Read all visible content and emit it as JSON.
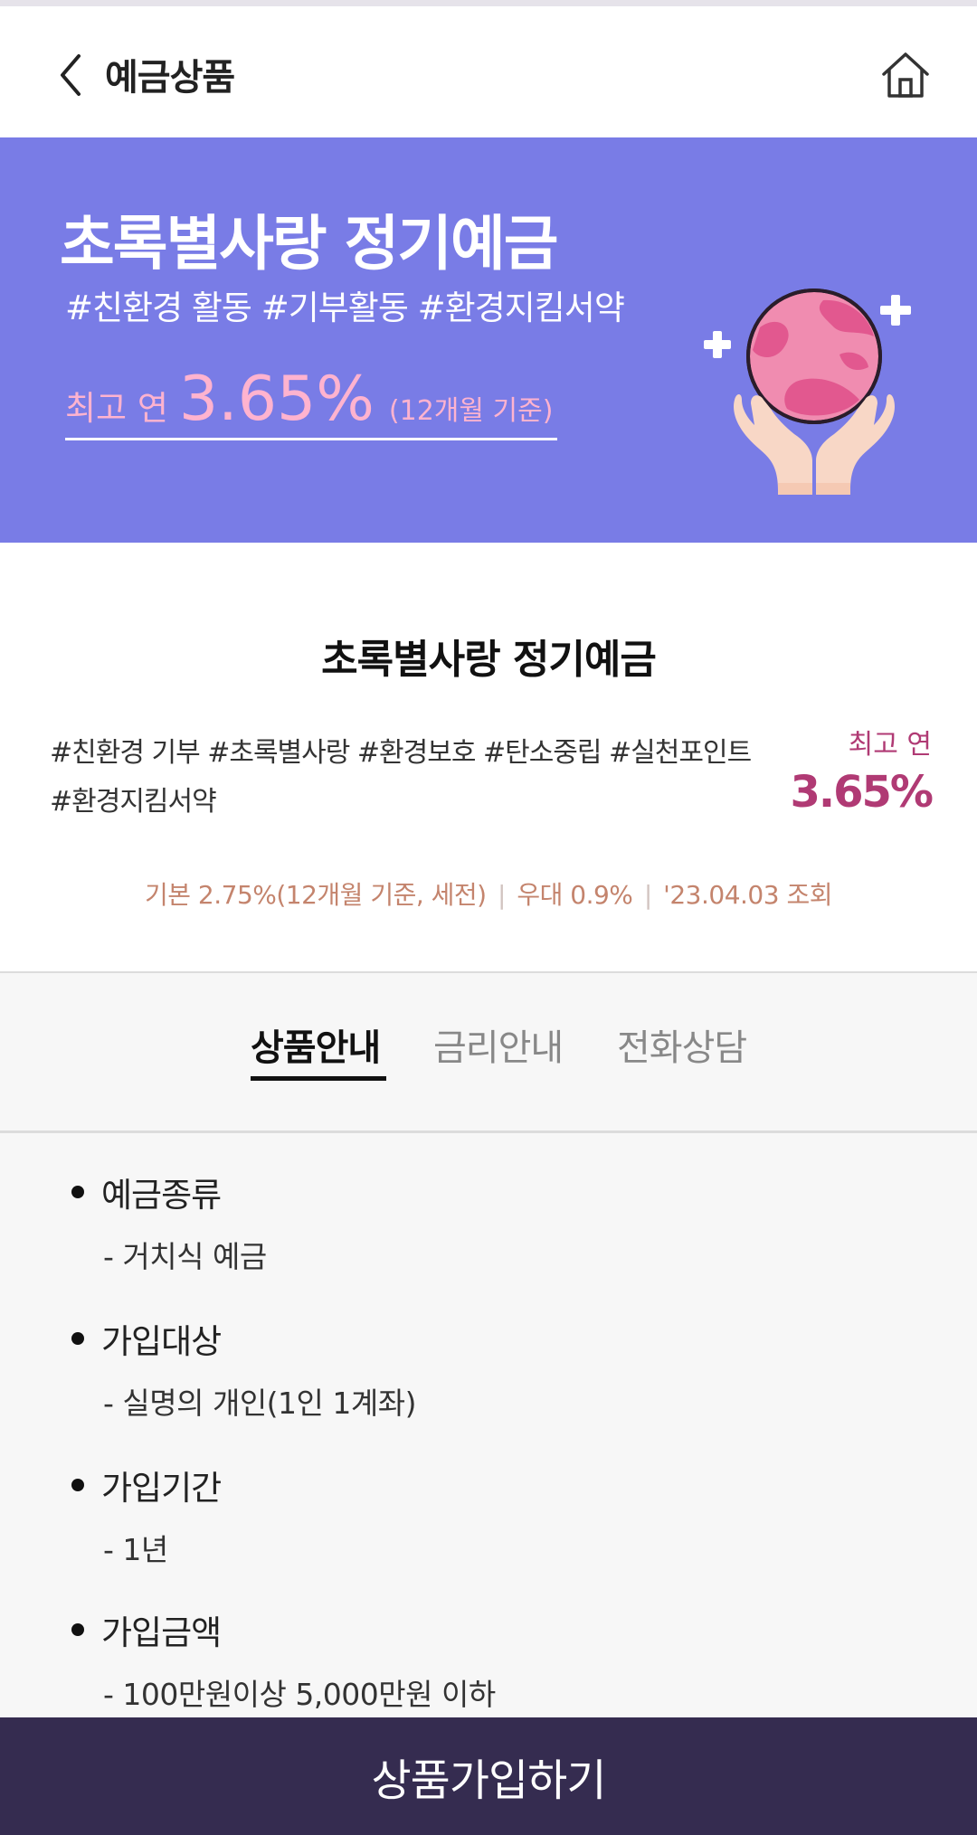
{
  "header": {
    "title": "예금상품",
    "back_icon": "chevron-left-icon",
    "home_icon": "home-icon"
  },
  "banner": {
    "title": "초록별사랑 정기예금",
    "tags": "#친환경 활동 #기부활동 #환경지킴서약",
    "rate_prefix": "최고 연",
    "rate_value": "3.65%",
    "rate_note": "(12개월 기준)",
    "illustration": "globe-in-hands-icon",
    "bg_color": "#797ce6"
  },
  "product": {
    "title": "초록별사랑 정기예금",
    "tags": "#친환경 기부 #초록별사랑 #환경보호 #탄소중립 #실천포인트 #환경지킴서약",
    "rate_label": "최고 연",
    "rate_value": "3.65%",
    "detail_base": "기본 2.75%(12개월 기준, 세전)",
    "detail_bonus": "우대 0.9%",
    "detail_date": "'23.04.03 조회",
    "accent_color": "#b03a74"
  },
  "tabs": [
    {
      "label": "상품안내",
      "active": true
    },
    {
      "label": "금리안내",
      "active": false
    },
    {
      "label": "전화상담",
      "active": false
    }
  ],
  "info": [
    {
      "heading": "예금종류",
      "body": "- 거치식 예금"
    },
    {
      "heading": "가입대상",
      "body": "- 실명의 개인(1인 1계좌)"
    },
    {
      "heading": "가입기간",
      "body": "- 1년"
    },
    {
      "heading": "가입금액",
      "body": "- 100만원이상 5,000만원 이하"
    }
  ],
  "cta": {
    "label": "상품가입하기",
    "bg_color": "#352c50"
  }
}
